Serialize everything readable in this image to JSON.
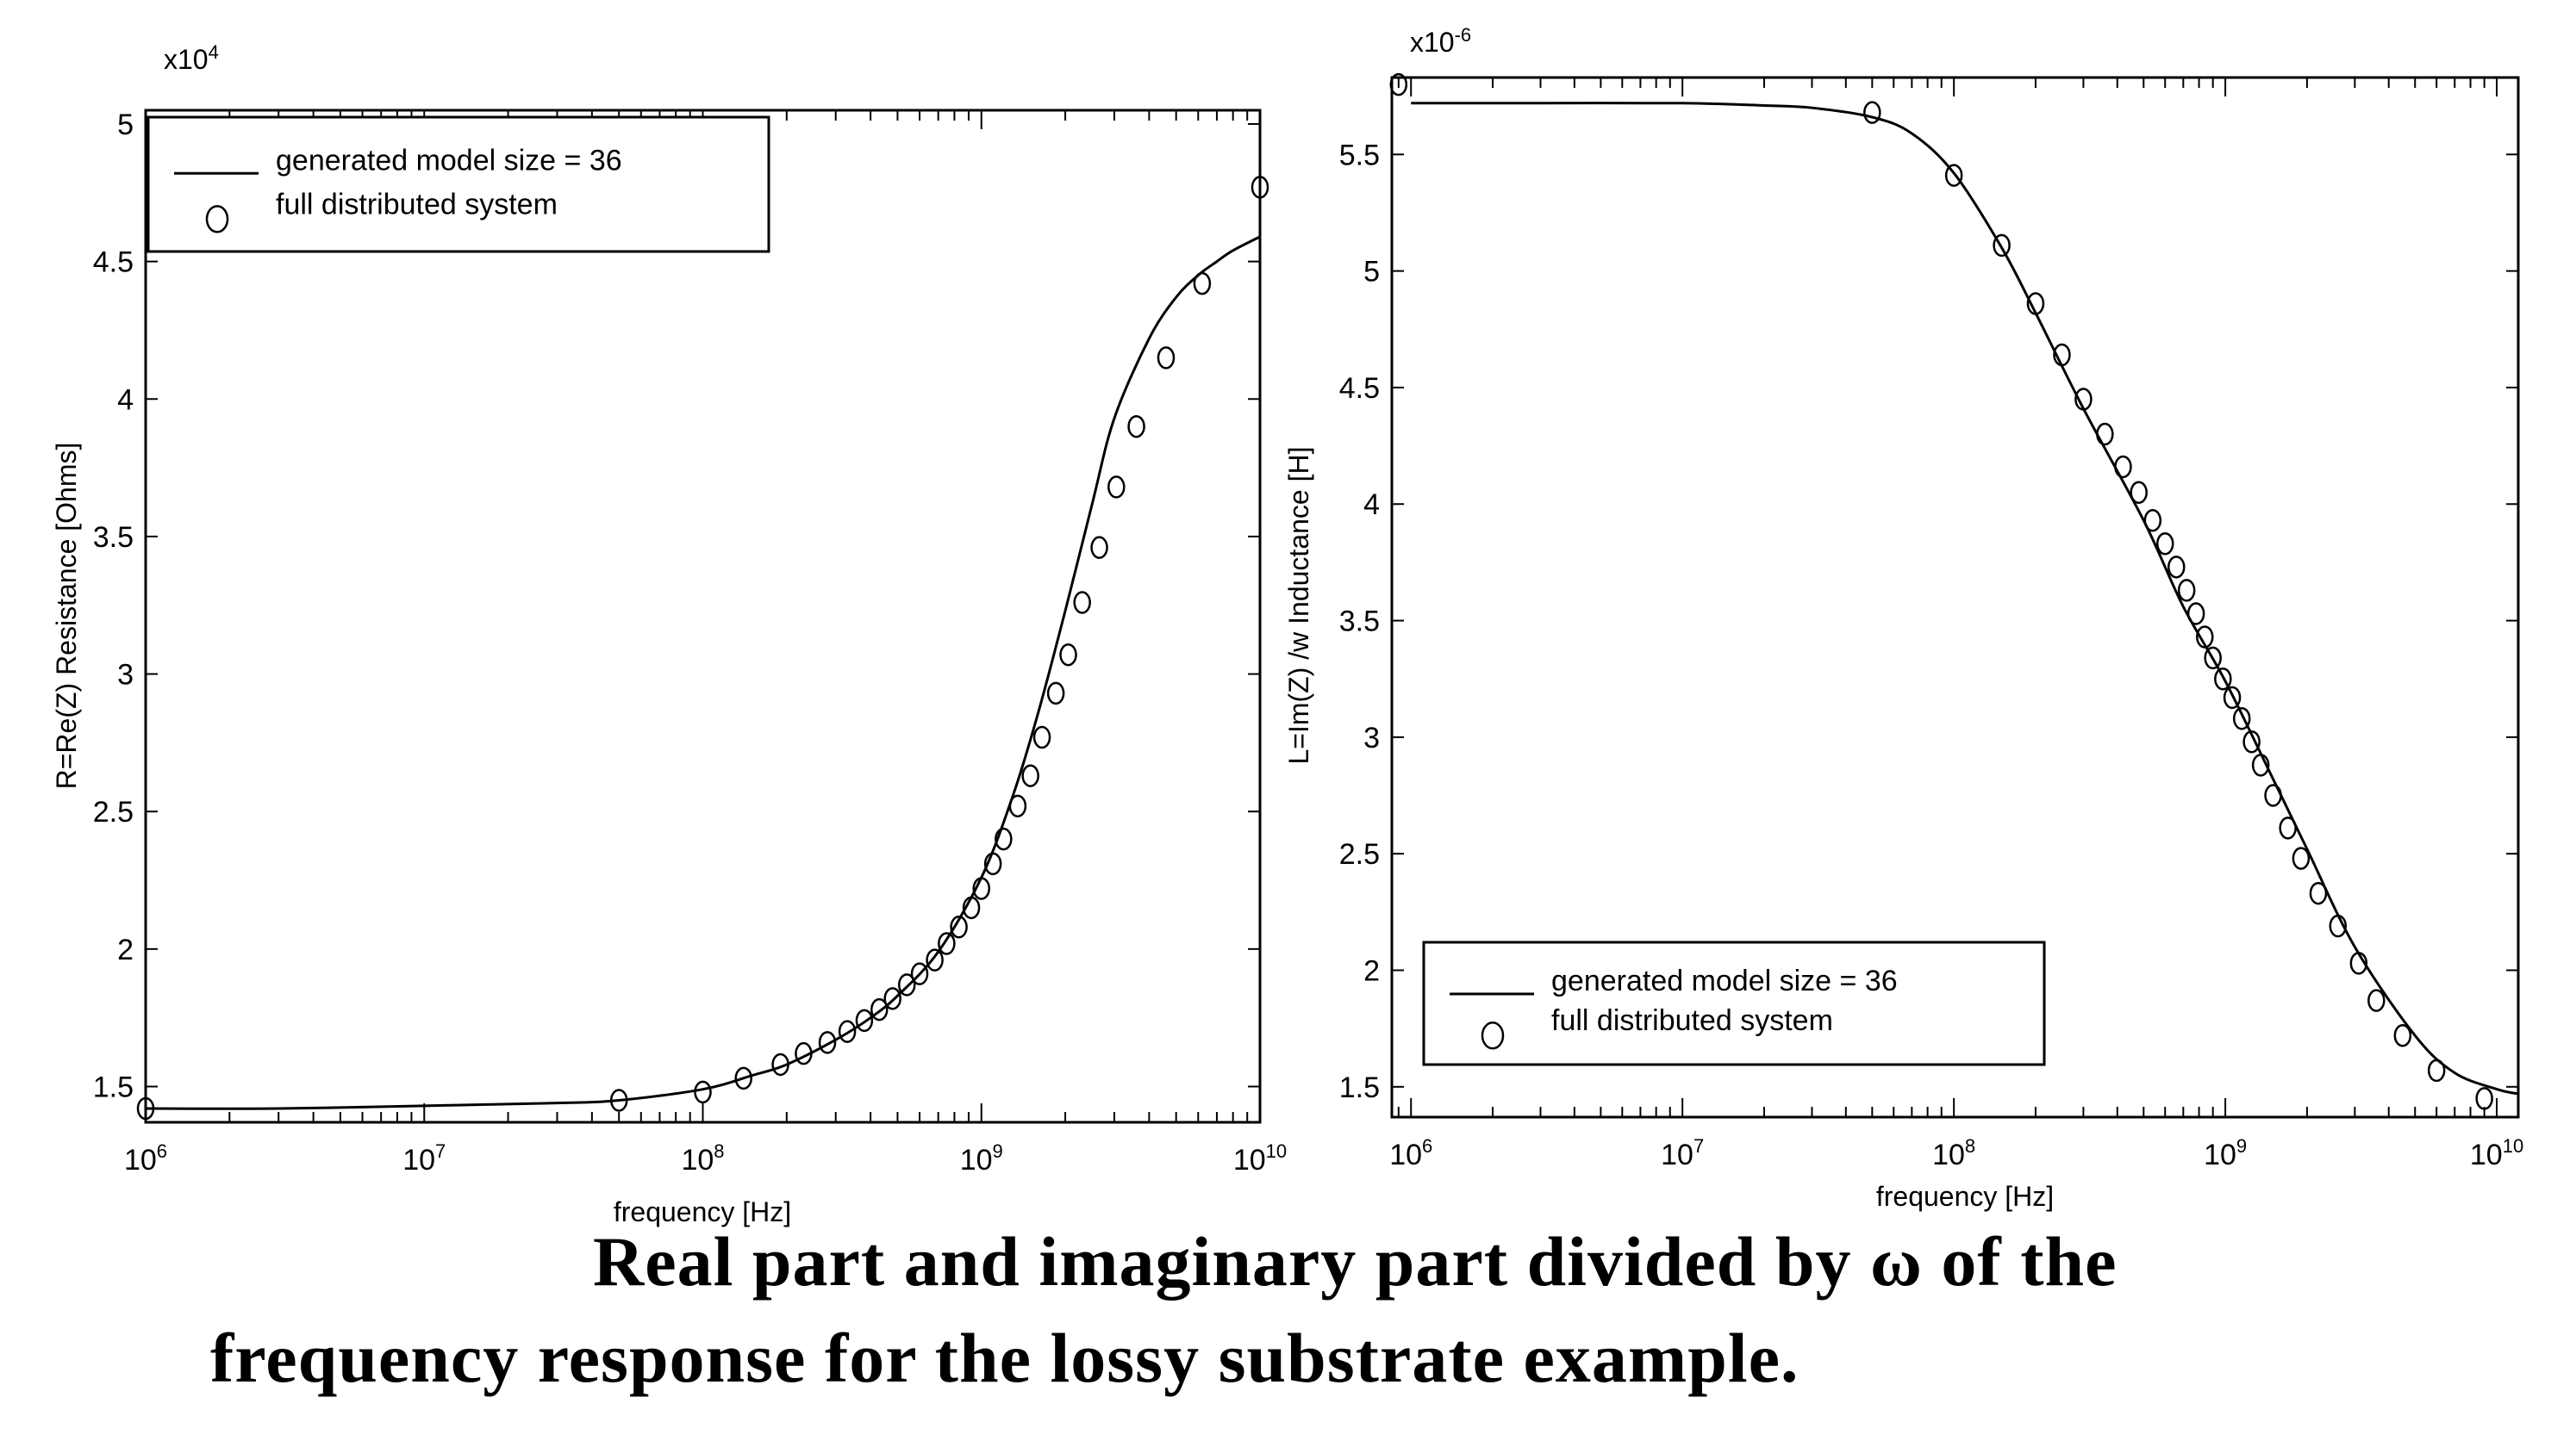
{
  "caption": {
    "line1": "Real part and imaginary part divided by ω of the",
    "line2": "frequency response for the lossy substrate example."
  },
  "chart_data": [
    {
      "type": "line",
      "title": "",
      "xlabel": "frequency [Hz]",
      "ylabel": "R=Re(Z)  Resistance [Ohms]",
      "y_multiplier": "x10^4",
      "xscale": "log",
      "xlim": [
        1000000.0,
        10000000000.0
      ],
      "ylim": [
        1.37,
        5.05
      ],
      "xticks": [
        {
          "value": 1000000.0,
          "base": "10",
          "exp": "6"
        },
        {
          "value": 10000000.0,
          "base": "10",
          "exp": "7"
        },
        {
          "value": 100000000.0,
          "base": "10",
          "exp": "8"
        },
        {
          "value": 1000000000.0,
          "base": "10",
          "exp": "9"
        },
        {
          "value": 10000000000.0,
          "base": "10",
          "exp": "10"
        }
      ],
      "yticks": [
        1.5,
        2,
        2.5,
        3,
        3.5,
        4,
        4.5,
        5
      ],
      "ytick_labels": [
        "1.5",
        "2",
        "2.5",
        "3",
        "3.5",
        "4",
        "4.5",
        "5"
      ],
      "grid": false,
      "legend": {
        "placement": "top-left",
        "entries": [
          {
            "label": "generated model size  =  36",
            "marker": "line"
          },
          {
            "label": "full distributed system",
            "marker": "circle"
          }
        ]
      },
      "series": [
        {
          "name": "generated model size = 36",
          "style": "line",
          "x": [
            1000000.0,
            3000000.0,
            10000000.0,
            30000000.0,
            50000000.0,
            100000000.0,
            150000000.0,
            200000000.0,
            300000000.0,
            400000000.0,
            500000000.0,
            700000000.0,
            1000000000.0,
            1300000000.0,
            1600000000.0,
            2000000000.0,
            2500000000.0,
            3000000000.0,
            4000000000.0,
            5000000000.0,
            6000000000.0,
            7000000000.0,
            8000000000.0,
            10000000000.0
          ],
          "y": [
            1.42,
            1.42,
            1.43,
            1.44,
            1.45,
            1.49,
            1.54,
            1.58,
            1.67,
            1.75,
            1.83,
            1.99,
            2.26,
            2.56,
            2.86,
            3.23,
            3.62,
            3.93,
            4.22,
            4.37,
            4.45,
            4.5,
            4.54,
            4.59
          ]
        },
        {
          "name": "full distributed system",
          "style": "circle",
          "x": [
            1000000.0,
            50000000.0,
            100000000.0,
            140000000.0,
            190000000.0,
            230000000.0,
            280000000.0,
            330000000.0,
            380000000.0,
            430000000.0,
            480000000.0,
            540000000.0,
            600000000.0,
            680000000.0,
            750000000.0,
            830000000.0,
            920000000.0,
            1000000000.0,
            1100000000.0,
            1200000000.0,
            1350000000.0,
            1500000000.0,
            1650000000.0,
            1850000000.0,
            2050000000.0,
            2300000000.0,
            2650000000.0,
            3050000000.0,
            3600000000.0,
            4600000000.0,
            6200000000.0,
            10000000000.0
          ],
          "y": [
            1.42,
            1.45,
            1.48,
            1.53,
            1.58,
            1.62,
            1.66,
            1.7,
            1.74,
            1.78,
            1.82,
            1.87,
            1.91,
            1.96,
            2.02,
            2.08,
            2.15,
            2.22,
            2.31,
            2.4,
            2.52,
            2.63,
            2.77,
            2.93,
            3.07,
            3.26,
            3.46,
            3.68,
            3.9,
            4.15,
            4.42,
            4.77
          ]
        }
      ]
    },
    {
      "type": "line",
      "title": "",
      "xlabel": "frequency [Hz]",
      "ylabel": "L=Im(Z) /w  Inductance [H]",
      "y_multiplier": "x10^-6",
      "xscale": "log",
      "xlim": [
        850000.0,
        12000000000.0
      ],
      "ylim": [
        1.37,
        5.83
      ],
      "xticks": [
        {
          "value": 1000000.0,
          "base": "10",
          "exp": "6"
        },
        {
          "value": 10000000.0,
          "base": "10",
          "exp": "7"
        },
        {
          "value": 100000000.0,
          "base": "10",
          "exp": "8"
        },
        {
          "value": 1000000000.0,
          "base": "10",
          "exp": "9"
        },
        {
          "value": 10000000000.0,
          "base": "10",
          "exp": "10"
        }
      ],
      "yticks": [
        1.5,
        2,
        2.5,
        3,
        3.5,
        4,
        4.5,
        5,
        5.5
      ],
      "ytick_labels": [
        "1.5",
        "2",
        "2.5",
        "3",
        "3.5",
        "4",
        "4.5",
        "5",
        "5.5"
      ],
      "grid": false,
      "legend": {
        "placement": "bottom-left",
        "entries": [
          {
            "label": "generated model size  =  36",
            "marker": "line"
          },
          {
            "label": "full distributed system",
            "marker": "circle"
          }
        ]
      },
      "series": [
        {
          "name": "generated model size = 36",
          "style": "line",
          "x": [
            1000000.0,
            3000000.0,
            10000000.0,
            20000000.0,
            30000000.0,
            50000000.0,
            70000000.0,
            100000000.0,
            150000000.0,
            200000000.0,
            300000000.0,
            500000000.0,
            700000000.0,
            1000000000.0,
            1500000000.0,
            2000000000.0,
            3000000000.0,
            5000000000.0,
            7000000000.0,
            10000000000.0,
            12000000000.0
          ],
          "y": [
            5.72,
            5.72,
            5.72,
            5.71,
            5.7,
            5.66,
            5.59,
            5.42,
            5.1,
            4.82,
            4.41,
            3.93,
            3.56,
            3.24,
            2.82,
            2.52,
            2.1,
            1.72,
            1.56,
            1.49,
            1.47
          ]
        },
        {
          "name": "full distributed system",
          "style": "circle",
          "x": [
            900000.0,
            50000000.0,
            100000000.0,
            150000000.0,
            200000000.0,
            250000000.0,
            300000000.0,
            360000000.0,
            420000000.0,
            480000000.0,
            540000000.0,
            600000000.0,
            660000000.0,
            720000000.0,
            780000000.0,
            840000000.0,
            900000000.0,
            980000000.0,
            1060000000.0,
            1150000000.0,
            1250000000.0,
            1350000000.0,
            1500000000.0,
            1700000000.0,
            1900000000.0,
            2200000000.0,
            2600000000.0,
            3100000000.0,
            3600000000.0,
            4500000000.0,
            6000000000.0,
            9000000000.0
          ],
          "y": [
            5.8,
            5.68,
            5.41,
            5.11,
            4.86,
            4.64,
            4.45,
            4.3,
            4.16,
            4.05,
            3.93,
            3.83,
            3.73,
            3.63,
            3.53,
            3.43,
            3.34,
            3.25,
            3.17,
            3.08,
            2.98,
            2.88,
            2.75,
            2.61,
            2.48,
            2.33,
            2.19,
            2.03,
            1.87,
            1.72,
            1.57,
            1.45
          ]
        }
      ]
    }
  ]
}
